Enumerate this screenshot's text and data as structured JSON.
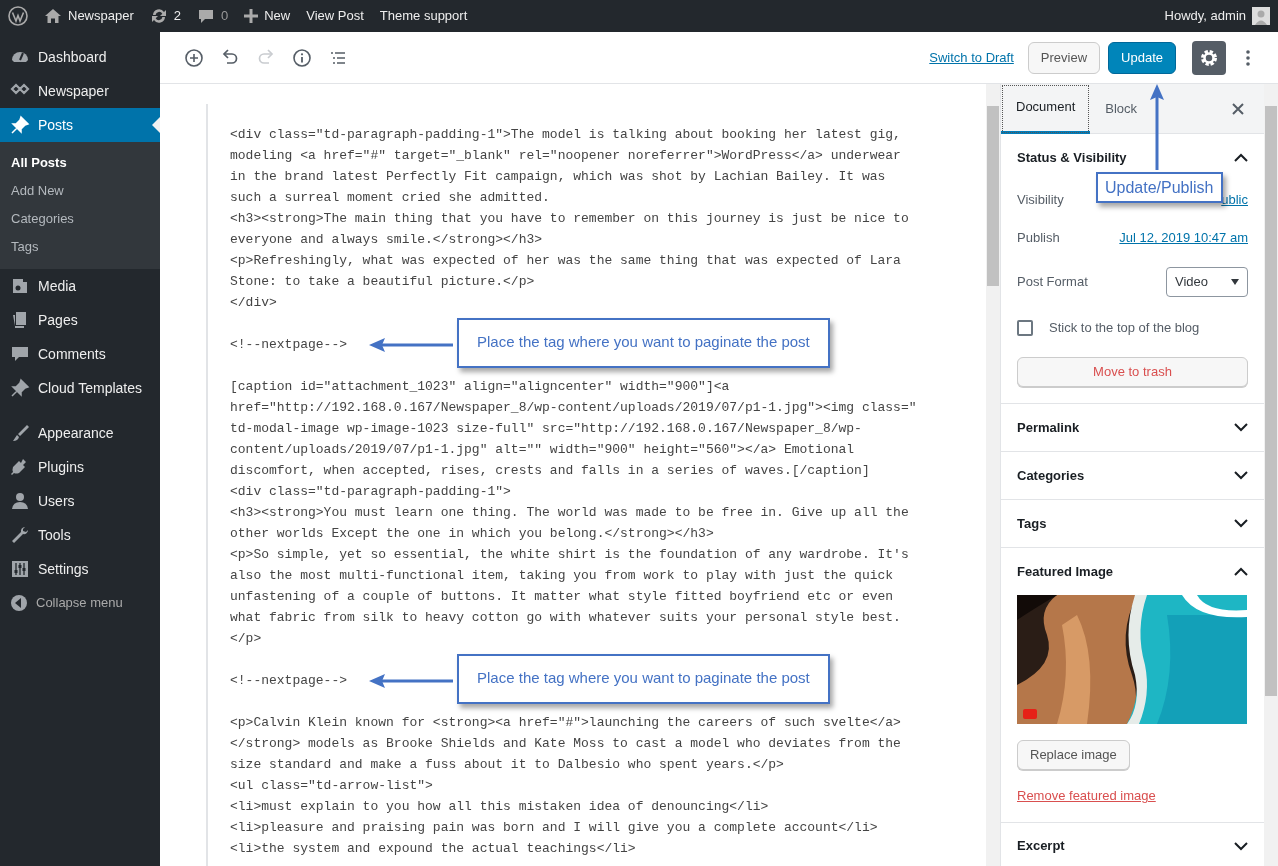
{
  "admin_bar": {
    "site": "Newspaper",
    "updates": "2",
    "comments": "0",
    "new": "New",
    "links": [
      "View Post",
      "Theme support"
    ],
    "greeting": "Howdy, admin"
  },
  "sidebar": {
    "groups": [
      [
        {
          "label": "Dashboard",
          "selected": false
        },
        {
          "label": "Newspaper",
          "selected": false
        },
        {
          "label": "Posts",
          "selected": true,
          "children": [
            {
              "label": "All Posts",
              "selected": true
            },
            {
              "label": "Add New",
              "selected": false
            },
            {
              "label": "Categories",
              "selected": false
            },
            {
              "label": "Tags",
              "selected": false
            }
          ]
        },
        {
          "label": "Media",
          "selected": false
        },
        {
          "label": "Pages",
          "selected": false
        },
        {
          "label": "Comments",
          "selected": false
        },
        {
          "label": "Cloud Templates",
          "selected": false
        }
      ],
      [
        {
          "label": "Appearance",
          "selected": false
        },
        {
          "label": "Plugins",
          "selected": false
        },
        {
          "label": "Users",
          "selected": false
        },
        {
          "label": "Tools",
          "selected": false
        },
        {
          "label": "Settings",
          "selected": false
        }
      ]
    ],
    "collapse": "Collapse menu"
  },
  "toolbar": {
    "tools": [
      {
        "disabled": false
      },
      {
        "disabled": false
      },
      {
        "disabled": true
      },
      {
        "disabled": false
      },
      {
        "disabled": false
      }
    ],
    "switch_link": "Switch to Draft",
    "preview": "Preview",
    "update": "Update"
  },
  "editor": {
    "sections": [
      {
        "kind": "code",
        "lines": [
          "<div class=\"td-paragraph-padding-1\">The model is talking about booking her latest gig,",
          "modeling <a href=\"#\" target=\"_blank\" rel=\"noopener noreferrer\">WordPress</a> underwear",
          "in the brand latest Perfectly Fit campaign, which was shot by Lachian Bailey. It was",
          "such a surreal moment cried she admitted.",
          "<h3><strong>The main thing that you have to remember on this journey is just be nice to",
          "everyone and always smile.</strong></h3>",
          "<p>Refreshingly, what was expected of her was the same thing that was expected of Lara",
          "Stone: to take a beautiful picture.</p>",
          "</div>"
        ]
      },
      {
        "kind": "marker",
        "text": "<!--nextpage-->",
        "callout": "Place the tag where you want to paginate the post"
      },
      {
        "kind": "code",
        "lines": [
          "[caption id=\"attachment_1023\" align=\"aligncenter\" width=\"900\"]<a",
          "href=\"http://192.168.0.167/Newspaper_8/wp-content/uploads/2019/07/p1-1.jpg\"><img class=\"",
          "td-modal-image wp-image-1023 size-full\" src=\"http://192.168.0.167/Newspaper_8/wp-",
          "content/uploads/2019/07/p1-1.jpg\" alt=\"\" width=\"900\" height=\"560\"></a> Emotional",
          "discomfort, when accepted, rises, crests and falls in a series of waves.[/caption]",
          "<div class=\"td-paragraph-padding-1\">",
          "<h3><strong>You must learn one thing. The world was made to be free in. Give up all the",
          "other worlds Except the one in which you belong.</strong></h3>",
          "<p>So simple, yet so essential, the white shirt is the foundation of any wardrobe. It's",
          "also the most multi-functional item, taking you from work to play with just the quick",
          "unfastening of a couple of buttons. It matter what style fitted boyfriend etc or even",
          "what fabric from silk to heavy cotton go with whatever suits your personal style best.",
          "</p>"
        ]
      },
      {
        "kind": "marker",
        "text": "<!--nextpage-->",
        "callout": "Place the tag where you want to paginate the post"
      },
      {
        "kind": "code",
        "lines": [
          "<p>Calvin Klein known for <strong><a href=\"#\">launching the careers of such svelte</a>",
          "</strong> models as Brooke Shields and Kate Moss to cast a model who deviates from the",
          "size standard and make a fuss about it to Dalbesio who spent years.</p>",
          "<ul class=\"td-arrow-list\">",
          "<li>must explain to you how all this mistaken idea of denouncing</li>",
          "<li>pleasure and praising pain was born and I will give you a complete account</li>",
          "<li>the system and expound the actual teachings</li>"
        ]
      }
    ]
  },
  "settings_panel": {
    "tabs": [
      {
        "label": "Document",
        "selected": true
      },
      {
        "label": "Block",
        "selected": false
      }
    ],
    "panels": [
      {
        "kind": "status",
        "title": "Status & Visibility",
        "expanded": true,
        "visibility_label": "Visibility",
        "visibility_value": "ublic",
        "publish_label": "Publish",
        "publish_value": "Jul 12, 2019 10:47 am",
        "format_label": "Post Format",
        "format_value": "Video",
        "sticky_label": "Stick to the top of the blog",
        "sticky_checked": false,
        "trash": "Move to trash"
      },
      {
        "title": "Permalink",
        "expanded": false
      },
      {
        "title": "Categories",
        "expanded": false
      },
      {
        "title": "Tags",
        "expanded": false
      },
      {
        "kind": "featured",
        "title": "Featured Image",
        "expanded": true,
        "replace": "Replace image",
        "remove": "Remove featured image"
      },
      {
        "title": "Excerpt",
        "expanded": false
      }
    ]
  },
  "annotation": {
    "text": "Update/Publish"
  }
}
